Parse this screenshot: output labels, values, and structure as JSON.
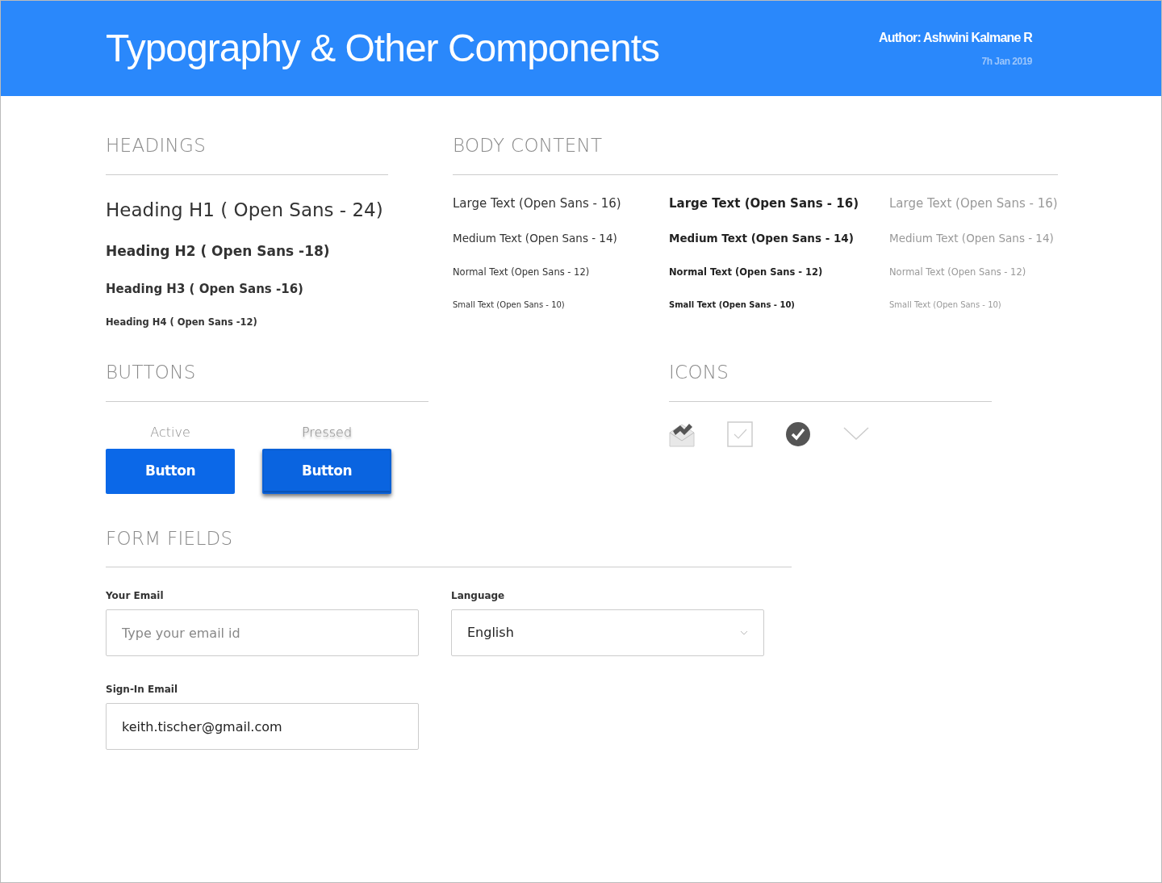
{
  "header": {
    "title": "Typography & Other Components",
    "author": "Author: Ashwini Kalmane R",
    "date": "7h Jan 2019"
  },
  "headings": {
    "title": "HEADINGS",
    "items": [
      {
        "kind": "h1",
        "text": "Heading H1 ( Open Sans - 24)"
      },
      {
        "kind": "h2",
        "text": "Heading H2 ( Open Sans -18)"
      },
      {
        "kind": "h3",
        "text": "Heading H3 ( Open Sans -16)"
      },
      {
        "kind": "h4",
        "text": "Heading H4 ( Open Sans -12)"
      }
    ]
  },
  "body_content": {
    "title": "BODY CONTENT",
    "columns": [
      {
        "kind": "regular",
        "items": [
          {
            "kind": "large",
            "text": "Large Text (Open Sans - 16)"
          },
          {
            "kind": "medium",
            "text": "Medium Text (Open Sans - 14)"
          },
          {
            "kind": "normal",
            "text": "Normal Text (Open Sans - 12)"
          },
          {
            "kind": "small",
            "text": "Small Text (Open Sans - 10)"
          }
        ]
      },
      {
        "kind": "bold",
        "items": [
          {
            "kind": "large",
            "text": "Large Text (Open Sans - 16)"
          },
          {
            "kind": "medium",
            "text": "Medium Text (Open Sans - 14)"
          },
          {
            "kind": "normal",
            "text": "Normal Text (Open Sans - 12)"
          },
          {
            "kind": "small",
            "text": "Small Text (Open Sans - 10)"
          }
        ]
      },
      {
        "kind": "light",
        "items": [
          {
            "kind": "large",
            "text": "Large Text (Open Sans - 16)"
          },
          {
            "kind": "medium",
            "text": "Medium Text (Open Sans - 14)"
          },
          {
            "kind": "normal",
            "text": "Normal Text (Open Sans - 12)"
          },
          {
            "kind": "small",
            "text": "Small Text (Open Sans - 10)"
          }
        ]
      }
    ]
  },
  "buttons": {
    "title": "BUTTONS",
    "items": [
      {
        "caption": "Active",
        "label": "Button",
        "pressed": false
      },
      {
        "caption": "Pressed",
        "label": "Button",
        "pressed": true
      }
    ]
  },
  "icons": {
    "title": "ICONS",
    "items": [
      {
        "kind": "envelope"
      },
      {
        "kind": "checkbox"
      },
      {
        "kind": "check-circle"
      },
      {
        "kind": "chevron"
      }
    ]
  },
  "form_fields": {
    "title": "FORM FIELDS",
    "fields": [
      {
        "kind": "input",
        "label": "Your Email",
        "placeholder": "Type your email id"
      },
      {
        "kind": "select",
        "label": "Language",
        "value": "English"
      },
      {
        "kind": "input",
        "label": "Sign-In Email",
        "value": "keith.tischer@gmail.com"
      }
    ]
  }
}
